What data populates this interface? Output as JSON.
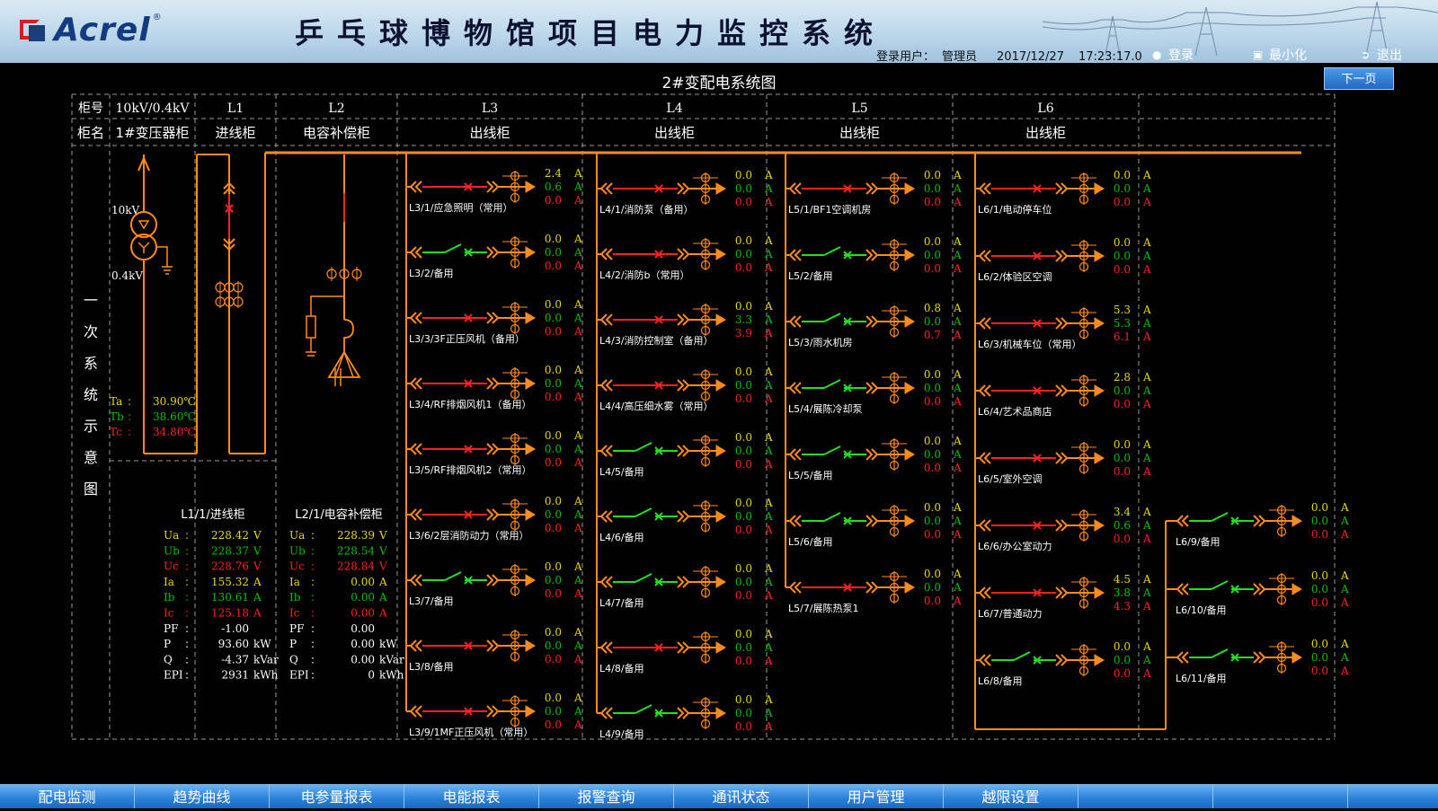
{
  "header": {
    "brand": "Acrel",
    "brand_mark": "®",
    "system_title": "乒乓球博物馆项目电力监控系统",
    "login_user_label": "登录用户：",
    "login_user": "管理员",
    "date": "2017/12/27",
    "time": "17:23:17.0",
    "login_btn": "登录",
    "minimize_btn": "最小化",
    "exit_btn": "退出",
    "icons": [
      "user-icon",
      "minimize-icon",
      "exit-icon"
    ]
  },
  "page": {
    "title": "2#变配电系统图",
    "next_btn": "下一页"
  },
  "table": {
    "row1_label": "柜号",
    "row2_label": "柜名",
    "cols": [
      {
        "no": "10kV/0.4kV",
        "name": "1#变压器柜"
      },
      {
        "no": "L1",
        "name": "进线柜"
      },
      {
        "no": "L2",
        "name": "电容补偿柜"
      },
      {
        "no": "L3",
        "name": "出线柜"
      },
      {
        "no": "L4",
        "name": "出线柜"
      },
      {
        "no": "L5",
        "name": "出线柜"
      },
      {
        "no": "L6",
        "name": "出线柜"
      }
    ]
  },
  "side_label": "一次系统示意图",
  "transformer": {
    "hv": "10kV",
    "lv": "0.4kV",
    "temps": [
      {
        "k": "Ta",
        "sep": ":",
        "v": "30.90℃",
        "color": "#e8d800"
      },
      {
        "k": "Tb",
        "sep": ":",
        "v": "38.60℃",
        "color": "#00c000"
      },
      {
        "k": "Tc",
        "sep": ":",
        "v": "34.80℃",
        "color": "#ff2020"
      }
    ]
  },
  "meters": [
    {
      "title": "L1/1/进线柜",
      "rows": [
        {
          "k": "Ua",
          "v": "228.42",
          "u": "V",
          "color": "#e8d800"
        },
        {
          "k": "Ub",
          "v": "228.37",
          "u": "V",
          "color": "#00c000"
        },
        {
          "k": "Uc",
          "v": "228.76",
          "u": "V",
          "color": "#ff2020"
        },
        {
          "k": "Ia",
          "v": "155.32",
          "u": "A",
          "color": "#e8d800"
        },
        {
          "k": "Ib",
          "v": "130.61",
          "u": "A",
          "color": "#00c000"
        },
        {
          "k": "Ic",
          "v": "125.18",
          "u": "A",
          "color": "#ff2020"
        },
        {
          "k": "PF",
          "v": "-1.00",
          "u": "",
          "color": "#ffffff"
        },
        {
          "k": "P",
          "v": "93.60",
          "u": "kW",
          "color": "#ffffff"
        },
        {
          "k": "Q",
          "v": "-4.37",
          "u": "kVar",
          "color": "#ffffff"
        },
        {
          "k": "EPI",
          "v": "2931",
          "u": "kWh",
          "color": "#ffffff"
        }
      ]
    },
    {
      "title": "L2/1/电容补偿柜",
      "rows": [
        {
          "k": "Ua",
          "v": "228.39",
          "u": "V",
          "color": "#e8d800"
        },
        {
          "k": "Ub",
          "v": "228.54",
          "u": "V",
          "color": "#00c000"
        },
        {
          "k": "Uc",
          "v": "228.84",
          "u": "V",
          "color": "#ff2020"
        },
        {
          "k": "Ia",
          "v": "0.00",
          "u": "A",
          "color": "#e8d800"
        },
        {
          "k": "Ib",
          "v": "0.00",
          "u": "A",
          "color": "#00c000"
        },
        {
          "k": "Ic",
          "v": "0.00",
          "u": "A",
          "color": "#ff2020"
        },
        {
          "k": "PF",
          "v": "0.00",
          "u": "",
          "color": "#ffffff"
        },
        {
          "k": "P",
          "v": "0.00",
          "u": "kW",
          "color": "#ffffff"
        },
        {
          "k": "Q",
          "v": "0.00",
          "u": "kVar",
          "color": "#ffffff"
        },
        {
          "k": "EPI",
          "v": "0",
          "u": "kWh",
          "color": "#ffffff"
        }
      ]
    }
  ],
  "feeders": [
    {
      "group": "L3",
      "items": [
        {
          "name": "L3/1/应急照明（常用）",
          "closed": true,
          "ia": "2.4",
          "ib": "0.6",
          "ic": "0.0"
        },
        {
          "name": "L3/2/备用",
          "closed": false,
          "ia": "0.0",
          "ib": "0.0",
          "ic": "0.0"
        },
        {
          "name": "L3/3/3F正压风机（备用）",
          "closed": true,
          "ia": "0.0",
          "ib": "0.0",
          "ic": "0.0"
        },
        {
          "name": "L3/4/RF排烟风机1（备用）",
          "closed": true,
          "ia": "0.0",
          "ib": "0.0",
          "ic": "0.0"
        },
        {
          "name": "L3/5/RF排烟风机2（常用）",
          "closed": true,
          "ia": "0.0",
          "ib": "0.0",
          "ic": "0.0"
        },
        {
          "name": "L3/6/2层消防动力（常用）",
          "closed": true,
          "ia": "0.0",
          "ib": "0.0",
          "ic": "0.0"
        },
        {
          "name": "L3/7/备用",
          "closed": false,
          "ia": "0.0",
          "ib": "0.0",
          "ic": "0.0"
        },
        {
          "name": "L3/8/备用",
          "closed": true,
          "ia": "0.0",
          "ib": "0.0",
          "ic": "0.0"
        },
        {
          "name": "L3/9/1MF正压风机（常用）",
          "closed": true,
          "ia": "0.0",
          "ib": "0.0",
          "ic": "0.0"
        }
      ]
    },
    {
      "group": "L4",
      "items": [
        {
          "name": "L4/1/消防泵（备用）",
          "closed": true,
          "ia": "0.0",
          "ib": "0.0",
          "ic": "0.0"
        },
        {
          "name": "L4/2/消防b（常用）",
          "closed": true,
          "ia": "0.0",
          "ib": "0.0",
          "ic": "0.0"
        },
        {
          "name": "L4/3/消防控制室（备用）",
          "closed": true,
          "ia": "0.0",
          "ib": "3.3",
          "ic": "3.9"
        },
        {
          "name": "L4/4/高压细水雾（常用）",
          "closed": true,
          "ia": "0.0",
          "ib": "0.0",
          "ic": "0.0"
        },
        {
          "name": "L4/5/备用",
          "closed": false,
          "ia": "0.0",
          "ib": "0.0",
          "ic": "0.0"
        },
        {
          "name": "L4/6/备用",
          "closed": false,
          "ia": "0.0",
          "ib": "0.0",
          "ic": "0.0"
        },
        {
          "name": "L4/7/备用",
          "closed": false,
          "ia": "0.0",
          "ib": "0.0",
          "ic": "0.0"
        },
        {
          "name": "L4/8/备用",
          "closed": true,
          "ia": "0.0",
          "ib": "0.0",
          "ic": "0.0"
        },
        {
          "name": "L4/9/备用",
          "closed": false,
          "ia": "0.0",
          "ib": "0.0",
          "ic": "0.0"
        }
      ]
    },
    {
      "group": "L5",
      "items": [
        {
          "name": "L5/1/BF1空调机房",
          "closed": true,
          "ia": "0.0",
          "ib": "0.0",
          "ic": "0.0"
        },
        {
          "name": "L5/2/备用",
          "closed": false,
          "ia": "0.0",
          "ib": "0.0",
          "ic": "0.0"
        },
        {
          "name": "L5/3/雨水机房",
          "closed": false,
          "ia": "0.8",
          "ib": "0.0",
          "ic": "0.7"
        },
        {
          "name": "L5/4/展陈冷却泵",
          "closed": false,
          "ia": "0.0",
          "ib": "0.0",
          "ic": "0.0"
        },
        {
          "name": "L5/5/备用",
          "closed": false,
          "ia": "0.0",
          "ib": "0.0",
          "ic": "0.0"
        },
        {
          "name": "L5/6/备用",
          "closed": false,
          "ia": "0.0",
          "ib": "0.0",
          "ic": "0.0"
        },
        {
          "name": "L5/7/展陈热泵1",
          "closed": true,
          "ia": "0.0",
          "ib": "0.0",
          "ic": "0.0"
        }
      ]
    },
    {
      "group": "L6",
      "items": [
        {
          "name": "L6/1/电动停车位",
          "closed": true,
          "ia": "0.0",
          "ib": "0.0",
          "ic": "0.0"
        },
        {
          "name": "L6/2/体验区空调",
          "closed": true,
          "ia": "0.0",
          "ib": "0.0",
          "ic": "0.0"
        },
        {
          "name": "L6/3/机械车位（常用）",
          "closed": true,
          "ia": "5.3",
          "ib": "5.3",
          "ic": "6.1"
        },
        {
          "name": "L6/4/艺术品商店",
          "closed": true,
          "ia": "2.8",
          "ib": "0.0",
          "ic": "0.0"
        },
        {
          "name": "L6/5/室外空调",
          "closed": true,
          "ia": "0.0",
          "ib": "0.0",
          "ic": "0.0"
        },
        {
          "name": "L6/6/办公室动力",
          "closed": true,
          "ia": "3.4",
          "ib": "0.6",
          "ic": "0.0"
        },
        {
          "name": "L6/7/普通动力",
          "closed": true,
          "ia": "4.5",
          "ib": "3.8",
          "ic": "4.3"
        },
        {
          "name": "L6/8/备用",
          "closed": false,
          "ia": "0.0",
          "ib": "0.0",
          "ic": "0.0"
        },
        {
          "name": "L6/9/备用",
          "closed": false,
          "ia": "0.0",
          "ib": "0.0",
          "ic": "0.0"
        },
        {
          "name": "L6/10/备用",
          "closed": false,
          "ia": "0.0",
          "ib": "0.0",
          "ic": "0.0"
        },
        {
          "name": "L6/11/备用",
          "closed": false,
          "ia": "0.0",
          "ib": "0.0",
          "ic": "0.0"
        }
      ]
    }
  ],
  "unit_a": "A",
  "nav": [
    "配电监测",
    "趋势曲线",
    "电参量报表",
    "电能报表",
    "报警查询",
    "通讯状态",
    "用户管理",
    "越限设置",
    "",
    ""
  ],
  "colors": {
    "bus": "#ff8c1a",
    "closed": "#ff2020",
    "open": "#20e020",
    "phase_a": "#e8d800",
    "phase_b": "#00c000",
    "phase_c": "#ff2020",
    "grid": "#9a9a9a"
  }
}
